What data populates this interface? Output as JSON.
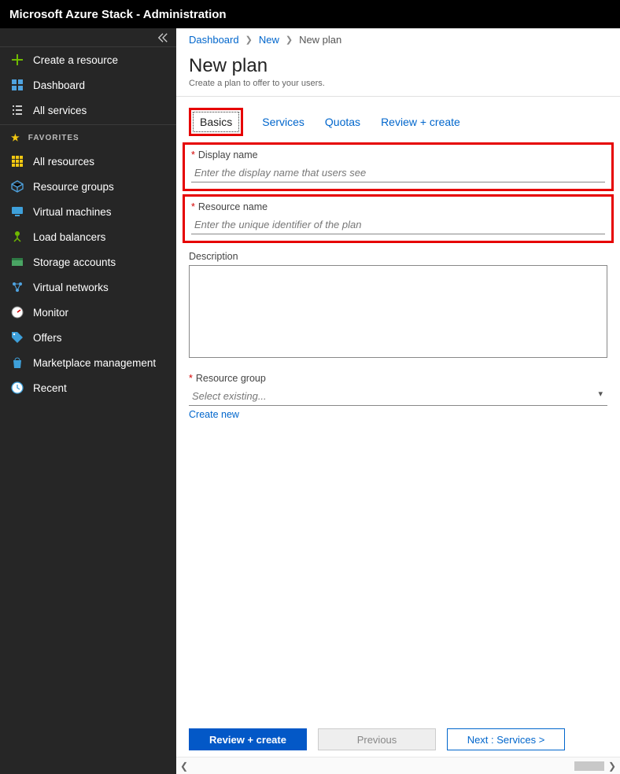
{
  "topbar": {
    "title": "Microsoft Azure Stack - Administration"
  },
  "sidebar": {
    "create": "Create a resource",
    "dashboard": "Dashboard",
    "allservices": "All services",
    "favorites_label": "FAVORITES",
    "items": [
      {
        "label": "All resources"
      },
      {
        "label": "Resource groups"
      },
      {
        "label": "Virtual machines"
      },
      {
        "label": "Load balancers"
      },
      {
        "label": "Storage accounts"
      },
      {
        "label": "Virtual networks"
      },
      {
        "label": "Monitor"
      },
      {
        "label": "Offers"
      },
      {
        "label": "Marketplace management"
      },
      {
        "label": "Recent"
      }
    ]
  },
  "breadcrumb": {
    "a": "Dashboard",
    "b": "New",
    "c": "New plan"
  },
  "page": {
    "title": "New plan",
    "subtitle": "Create a plan to offer to your users."
  },
  "tabs": {
    "basics": "Basics",
    "services": "Services",
    "quotas": "Quotas",
    "review": "Review + create"
  },
  "form": {
    "display_name": {
      "label": "Display name",
      "placeholder": "Enter the display name that users see",
      "value": ""
    },
    "resource_name": {
      "label": "Resource name",
      "placeholder": "Enter the unique identifier of the plan",
      "value": ""
    },
    "description": {
      "label": "Description",
      "value": ""
    },
    "resource_group": {
      "label": "Resource group",
      "placeholder": "Select existing...",
      "value": "",
      "create_new": "Create new"
    }
  },
  "footer": {
    "review": "Review + create",
    "previous": "Previous",
    "next": "Next : Services >"
  }
}
